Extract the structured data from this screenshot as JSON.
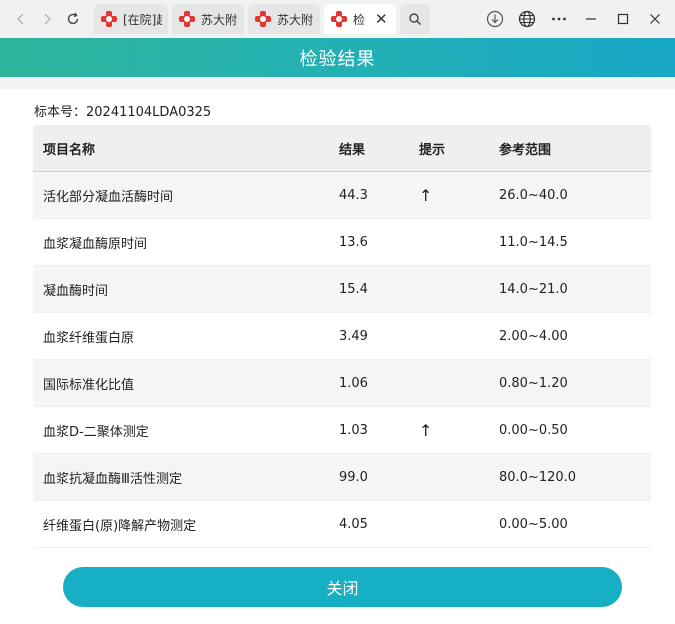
{
  "browser": {
    "tabs": [
      {
        "title": "[在院]超"
      },
      {
        "title": "苏大附"
      },
      {
        "title": "苏大附"
      },
      {
        "title": "检",
        "close": "✕"
      }
    ]
  },
  "page": {
    "title": "检验结果",
    "specimen_label": "标本号：",
    "specimen_no": "20241104LDA0325",
    "close_label": "关闭"
  },
  "table": {
    "headers": [
      "项目名称",
      "结果",
      "提示",
      "参考范围"
    ],
    "rows": [
      {
        "name": "活化部分凝血活酶时间",
        "result": "44.3",
        "hint": "↑",
        "range": "26.0~40.0"
      },
      {
        "name": "血浆凝血酶原时间",
        "result": "13.6",
        "hint": "",
        "range": "11.0~14.5"
      },
      {
        "name": "凝血酶时间",
        "result": "15.4",
        "hint": "",
        "range": "14.0~21.0"
      },
      {
        "name": "血浆纤维蛋白原",
        "result": "3.49",
        "hint": "",
        "range": "2.00~4.00"
      },
      {
        "name": "国际标准化比值",
        "result": "1.06",
        "hint": "",
        "range": "0.80~1.20"
      },
      {
        "name": "血浆D-二聚体测定",
        "result": "1.03",
        "hint": "↑",
        "range": "0.00~0.50"
      },
      {
        "name": "血浆抗凝血酶Ⅲ活性测定",
        "result": "99.0",
        "hint": "",
        "range": "80.0~120.0"
      },
      {
        "name": "纤维蛋白(原)降解产物测定",
        "result": "4.05",
        "hint": "",
        "range": "0.00~5.00"
      }
    ]
  },
  "colors": {
    "header_start": "#2fb59c",
    "header_end": "#18a7c6",
    "button": "#16afc3",
    "tab_favicon": "#e8342f"
  }
}
